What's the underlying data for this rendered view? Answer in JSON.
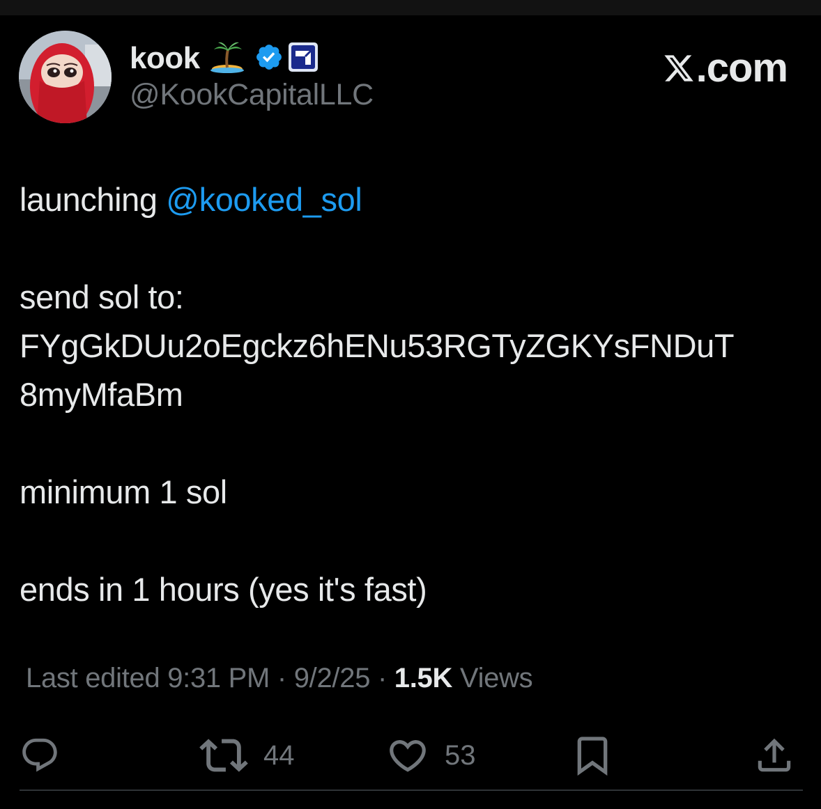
{
  "header": {
    "display_name": "kook",
    "handle": "@KookCapitalLLC",
    "emoji_icon": "desert-island-icon",
    "badge_icon": "verified-badge-icon",
    "affiliate_icon": "affiliate-badge-icon",
    "site_logo_text": ".com"
  },
  "tweet": {
    "line1_prefix": "launching ",
    "mention": "@kooked_sol",
    "line2": "send sol to:",
    "line3": "FYgGkDUu2oEgckz6hENu53RGTyZGKYsFNDuT",
    "line4": "8myMfaBm",
    "line5": "minimum 1 sol",
    "line6": "ends in 1 hours (yes it's fast)"
  },
  "meta": {
    "edited_label": "Last edited 9:31 PM · 9/2/25 · ",
    "views_count": "1.5K",
    "views_label": " Views"
  },
  "actions": {
    "reply_icon": "reply-icon",
    "retweet_icon": "retweet-icon",
    "retweets": "44",
    "like_icon": "heart-icon",
    "likes": "53",
    "bookmark_icon": "bookmark-icon",
    "share_icon": "share-icon"
  },
  "colors": {
    "background": "#000000",
    "text": "#e7e9ea",
    "muted": "#71767b",
    "accent": "#1d9bf0"
  }
}
